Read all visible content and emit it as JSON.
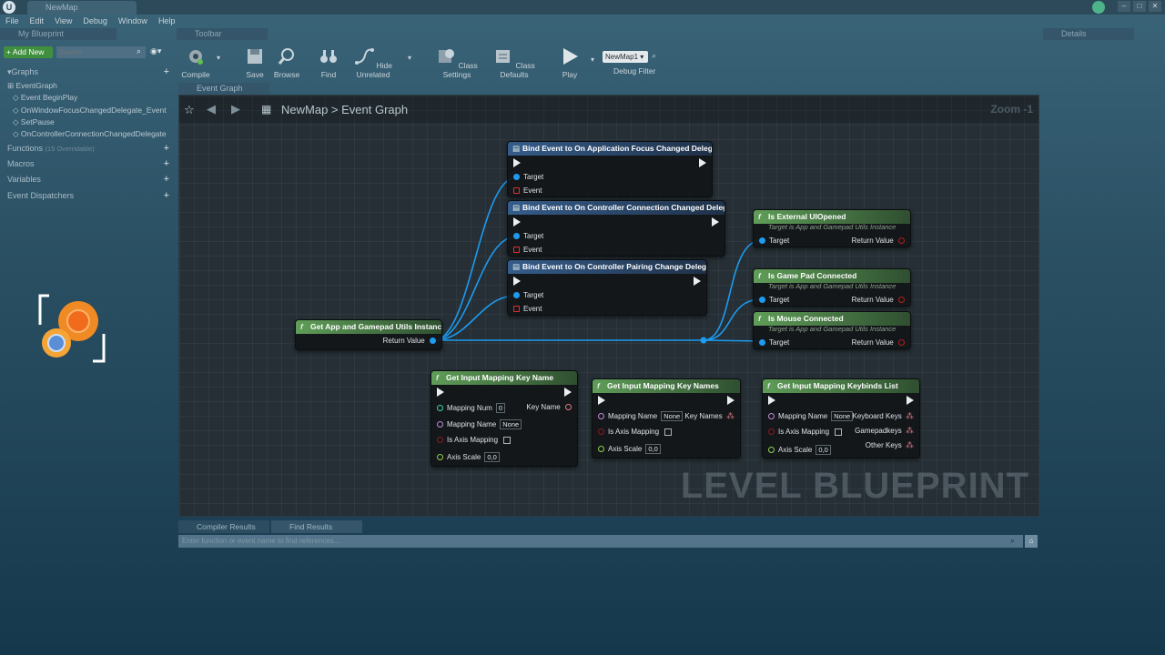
{
  "window": {
    "tab": "NewMap"
  },
  "menu": [
    "File",
    "Edit",
    "View",
    "Debug",
    "Window",
    "Help"
  ],
  "left_panel": {
    "title": "My Blueprint",
    "add_new": "+ Add New",
    "search_placeholder": "Search",
    "graphs_label": "Graphs",
    "event_graph": "EventGraph",
    "events": [
      "Event BeginPlay",
      "OnWindowFocusChangedDelegate_Event",
      "SetPause",
      "OnControllerConnectionChangedDelegate"
    ],
    "functions_label": "Functions",
    "functions_count": "(15 Overridable)",
    "macros_label": "Macros",
    "variables_label": "Variables",
    "dispatchers_label": "Event Dispatchers"
  },
  "toolbar": {
    "title": "Toolbar",
    "compile": "Compile",
    "save": "Save",
    "browse": "Browse",
    "find": "Find",
    "hide_unrelated": "Hide Unrelated",
    "class_settings": "Class Settings",
    "class_defaults": "Class Defaults",
    "play": "Play",
    "debug_select": "NewMap1",
    "debug_filter": "Debug Filter"
  },
  "details": {
    "title": "Details"
  },
  "graph": {
    "tab": "Event Graph",
    "crumb_root": "NewMap",
    "crumb_sep": ">",
    "crumb_leaf": "Event Graph",
    "zoom": "Zoom -1",
    "watermark": "LEVEL BLUEPRINT"
  },
  "nodes": {
    "get_instance": {
      "title": "Get App and Gamepad Utils Instance",
      "out": "Return Value"
    },
    "bind1": {
      "title": "Bind Event to On Application Focus Changed Delegate",
      "target": "Target",
      "event": "Event"
    },
    "bind2": {
      "title": "Bind Event to On Controller Connection Changed Delegate",
      "target": "Target",
      "event": "Event"
    },
    "bind3": {
      "title": "Bind Event to On Controller Pairing Change Delegate",
      "target": "Target",
      "event": "Event"
    },
    "ext_ui": {
      "title": "Is External UIOpened",
      "sub": "Target is App and Gamepad Utils Instance",
      "target": "Target",
      "out": "Return Value"
    },
    "gamepad": {
      "title": "Is Game Pad Connected",
      "sub": "Target is App and Gamepad Utils Instance",
      "target": "Target",
      "out": "Return Value"
    },
    "mouse": {
      "title": "Is Mouse Connected",
      "sub": "Target is App and Gamepad Utils Instance",
      "target": "Target",
      "out": "Return Value"
    },
    "key_name": {
      "title": "Get Input Mapping Key Name",
      "num_label": "Mapping Num",
      "num_val": "0",
      "out": "Key Name",
      "name_label": "Mapping Name",
      "name_val": "None",
      "axis_label": "Is Axis Mapping",
      "scale_label": "Axis Scale",
      "scale_val": "0,0"
    },
    "key_names": {
      "title": "Get Input Mapping Key Names",
      "name_label": "Mapping Name",
      "name_val": "None",
      "out": "Key Names",
      "axis_label": "Is Axis Mapping",
      "scale_label": "Axis Scale",
      "scale_val": "0,0"
    },
    "keybinds": {
      "title": "Get Input Mapping Keybinds List",
      "name_label": "Mapping Name",
      "name_val": "None",
      "out1": "Keyboard Keys",
      "axis_label": "Is Axis Mapping",
      "out2": "Gamepadkeys",
      "out3": "Other Keys",
      "scale_label": "Axis Scale",
      "scale_val": "0,0"
    }
  },
  "bottom": {
    "compiler_tab": "Compiler Results",
    "find_tab": "Find Results",
    "find_placeholder": "Enter function or event name to find references..."
  },
  "colors": {
    "object_pin": "#1d9bf0",
    "bool_pin": "#8c1b1b",
    "name_pin": "#c08ad8",
    "float_pin": "#8fd14f",
    "int_pin": "#3fd1b0",
    "wire": "#1d9bf0"
  }
}
